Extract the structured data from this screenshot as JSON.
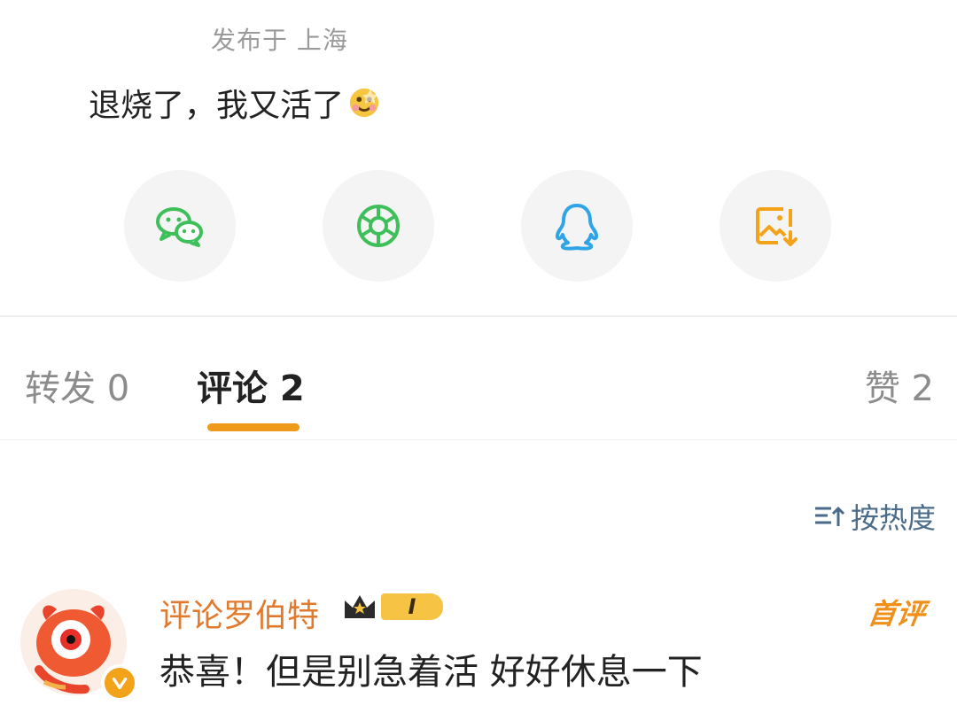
{
  "post": {
    "location": "发布于 上海",
    "text": "退烧了，我又活了"
  },
  "share": {
    "items": [
      {
        "icon": "wechat-icon",
        "color": "#3fbf5a"
      },
      {
        "icon": "moments-icon",
        "color": "#3fbf5a"
      },
      {
        "icon": "qq-icon",
        "color": "#2fa4e7"
      },
      {
        "icon": "save-image-icon",
        "color": "#f2a31a"
      }
    ]
  },
  "tabs": {
    "repost": "转发 0",
    "comments": "评论 2",
    "likes": "赞 2"
  },
  "sort": {
    "label": "按热度"
  },
  "comment": {
    "username": "评论罗伯特",
    "badge_level": "I",
    "text": "恭喜！但是别急着活 好好休息一下",
    "tag": "首评"
  },
  "colors": {
    "accent": "#f09a1b",
    "username": "#e17a2d",
    "link": "#4a6b8a"
  }
}
